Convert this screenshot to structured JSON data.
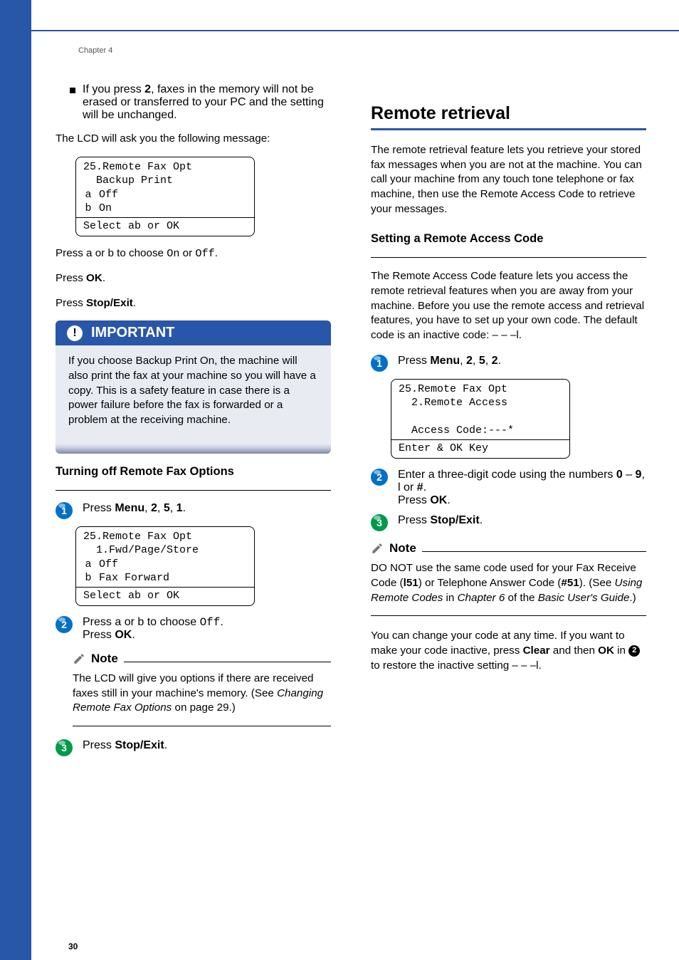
{
  "header": {
    "chapter_label": "Chapter 4"
  },
  "left_col": {
    "bullet_text_before": "If you press ",
    "bullet_key": "2",
    "bullet_text_after": ", faxes in the memory will not be erased or transferred to your PC and the setting will be unchanged.",
    "lcd_intro": "The LCD will ask you the following message:",
    "lcd1": {
      "line1": "25.Remote Fax Opt",
      "line2": "  Backup Print",
      "opt_off": "Off",
      "opt_on": "On",
      "footer": "Select ab or OK"
    },
    "press_updown_before": "Press ",
    "press_updown_mid": " or ",
    "press_updown_choose": " to choose ",
    "on_literal": "On",
    "or_literal": " or ",
    "off_literal": "Off",
    "period": ".",
    "press_ok_before": "Press ",
    "ok_label": "OK",
    "press_stopexit_before": "Press ",
    "stopexit_label": "Stop/Exit",
    "important_title": "IMPORTANT",
    "important_body": "If you choose Backup Print On, the machine will also print the fax at your machine so you will have a copy. This is a safety feature in case there is a power failure before the fax is forwarded or a problem at the receiving machine.",
    "turn_off_heading": "Turning off Remote Fax Options",
    "step1_before": "Press ",
    "menu_label": "Menu",
    "step1_after": ", ",
    "k2": "2",
    "k5": "5",
    "k1": "1",
    "lcd2": {
      "line1": "25.Remote Fax Opt",
      "line2": "  1.Fwd/Page/Store",
      "opt_off": "Off",
      "opt_fwd": "Fax Forward",
      "footer": "Select ab or OK"
    },
    "step2_before": "Press ",
    "step2_choose": " to choose ",
    "badge1": "1",
    "badge2": "2",
    "badge3": "3",
    "note_label": "Note",
    "note_text_a": "The LCD will give you options if there are received faxes still in your machine's memory. (See ",
    "note_text_italic": "Changing Remote Fax Options",
    "note_text_b": " on page 29.)",
    "step3_text_before": "Press ",
    "step3_text_after": "."
  },
  "right_col": {
    "section_title": "Remote retrieval",
    "intro": "The remote retrieval feature lets you retrieve your stored fax messages when you are not at the machine. You can call your machine from any touch tone telephone or fax machine, then use the Remote Access Code to retrieve your messages.",
    "sub_heading": "Setting a Remote Access Code",
    "sub_para": "The Remote Access Code feature lets you access the remote retrieval features when you are away from your machine. Before you use the remote access and retrieval features, you have to set up your own code. The default code is an inactive code: – – –l.",
    "step1_before": "Press ",
    "menu_label": "Menu",
    "k2a": "2",
    "k5a": "5",
    "k2b": "2",
    "lcd3": {
      "line1": "25.Remote Fax Opt",
      "line2": "  2.Remote Access",
      "blank": " ",
      "line3": "  Access Code:---*",
      "footer": "Enter & OK Key"
    },
    "badge1": "1",
    "badge2": "2",
    "badge3": "3",
    "step2_a": "Enter a three-digit code using the numbers ",
    "n0": "0",
    "dash": " – ",
    "n9": "9",
    "comma_star": ", l or ",
    "hash": "#",
    "step2_end": ".",
    "press_ok_before": "Press ",
    "ok_label": "OK",
    "step3_before": "Press ",
    "stopexit_label": "Stop/Exit",
    "note_label": "Note",
    "note_text_a": "DO NOT use the same code used for your Fax Receive Code (",
    "star51": "l51",
    "note_text_b": ") or Telephone Answer Code (",
    "hash51": "#51",
    "note_text_c": "). (See ",
    "note_text_italic": "Using Remote Codes",
    "note_text_d": " in ",
    "note_text_italic2": "Chapter 6",
    "note_text_e": " of the ",
    "note_text_italic3": "Basic User's Guide",
    "note_text_f": ".)",
    "closing_a": "You can change your code at any time. If you want to make your code inactive, press ",
    "clear": "Clear",
    "closing_b": " and then ",
    "closing_c": " in ",
    "closing_badge": "2",
    "closing_d": " to restore the inactive setting – – –l."
  },
  "page_no": "30"
}
